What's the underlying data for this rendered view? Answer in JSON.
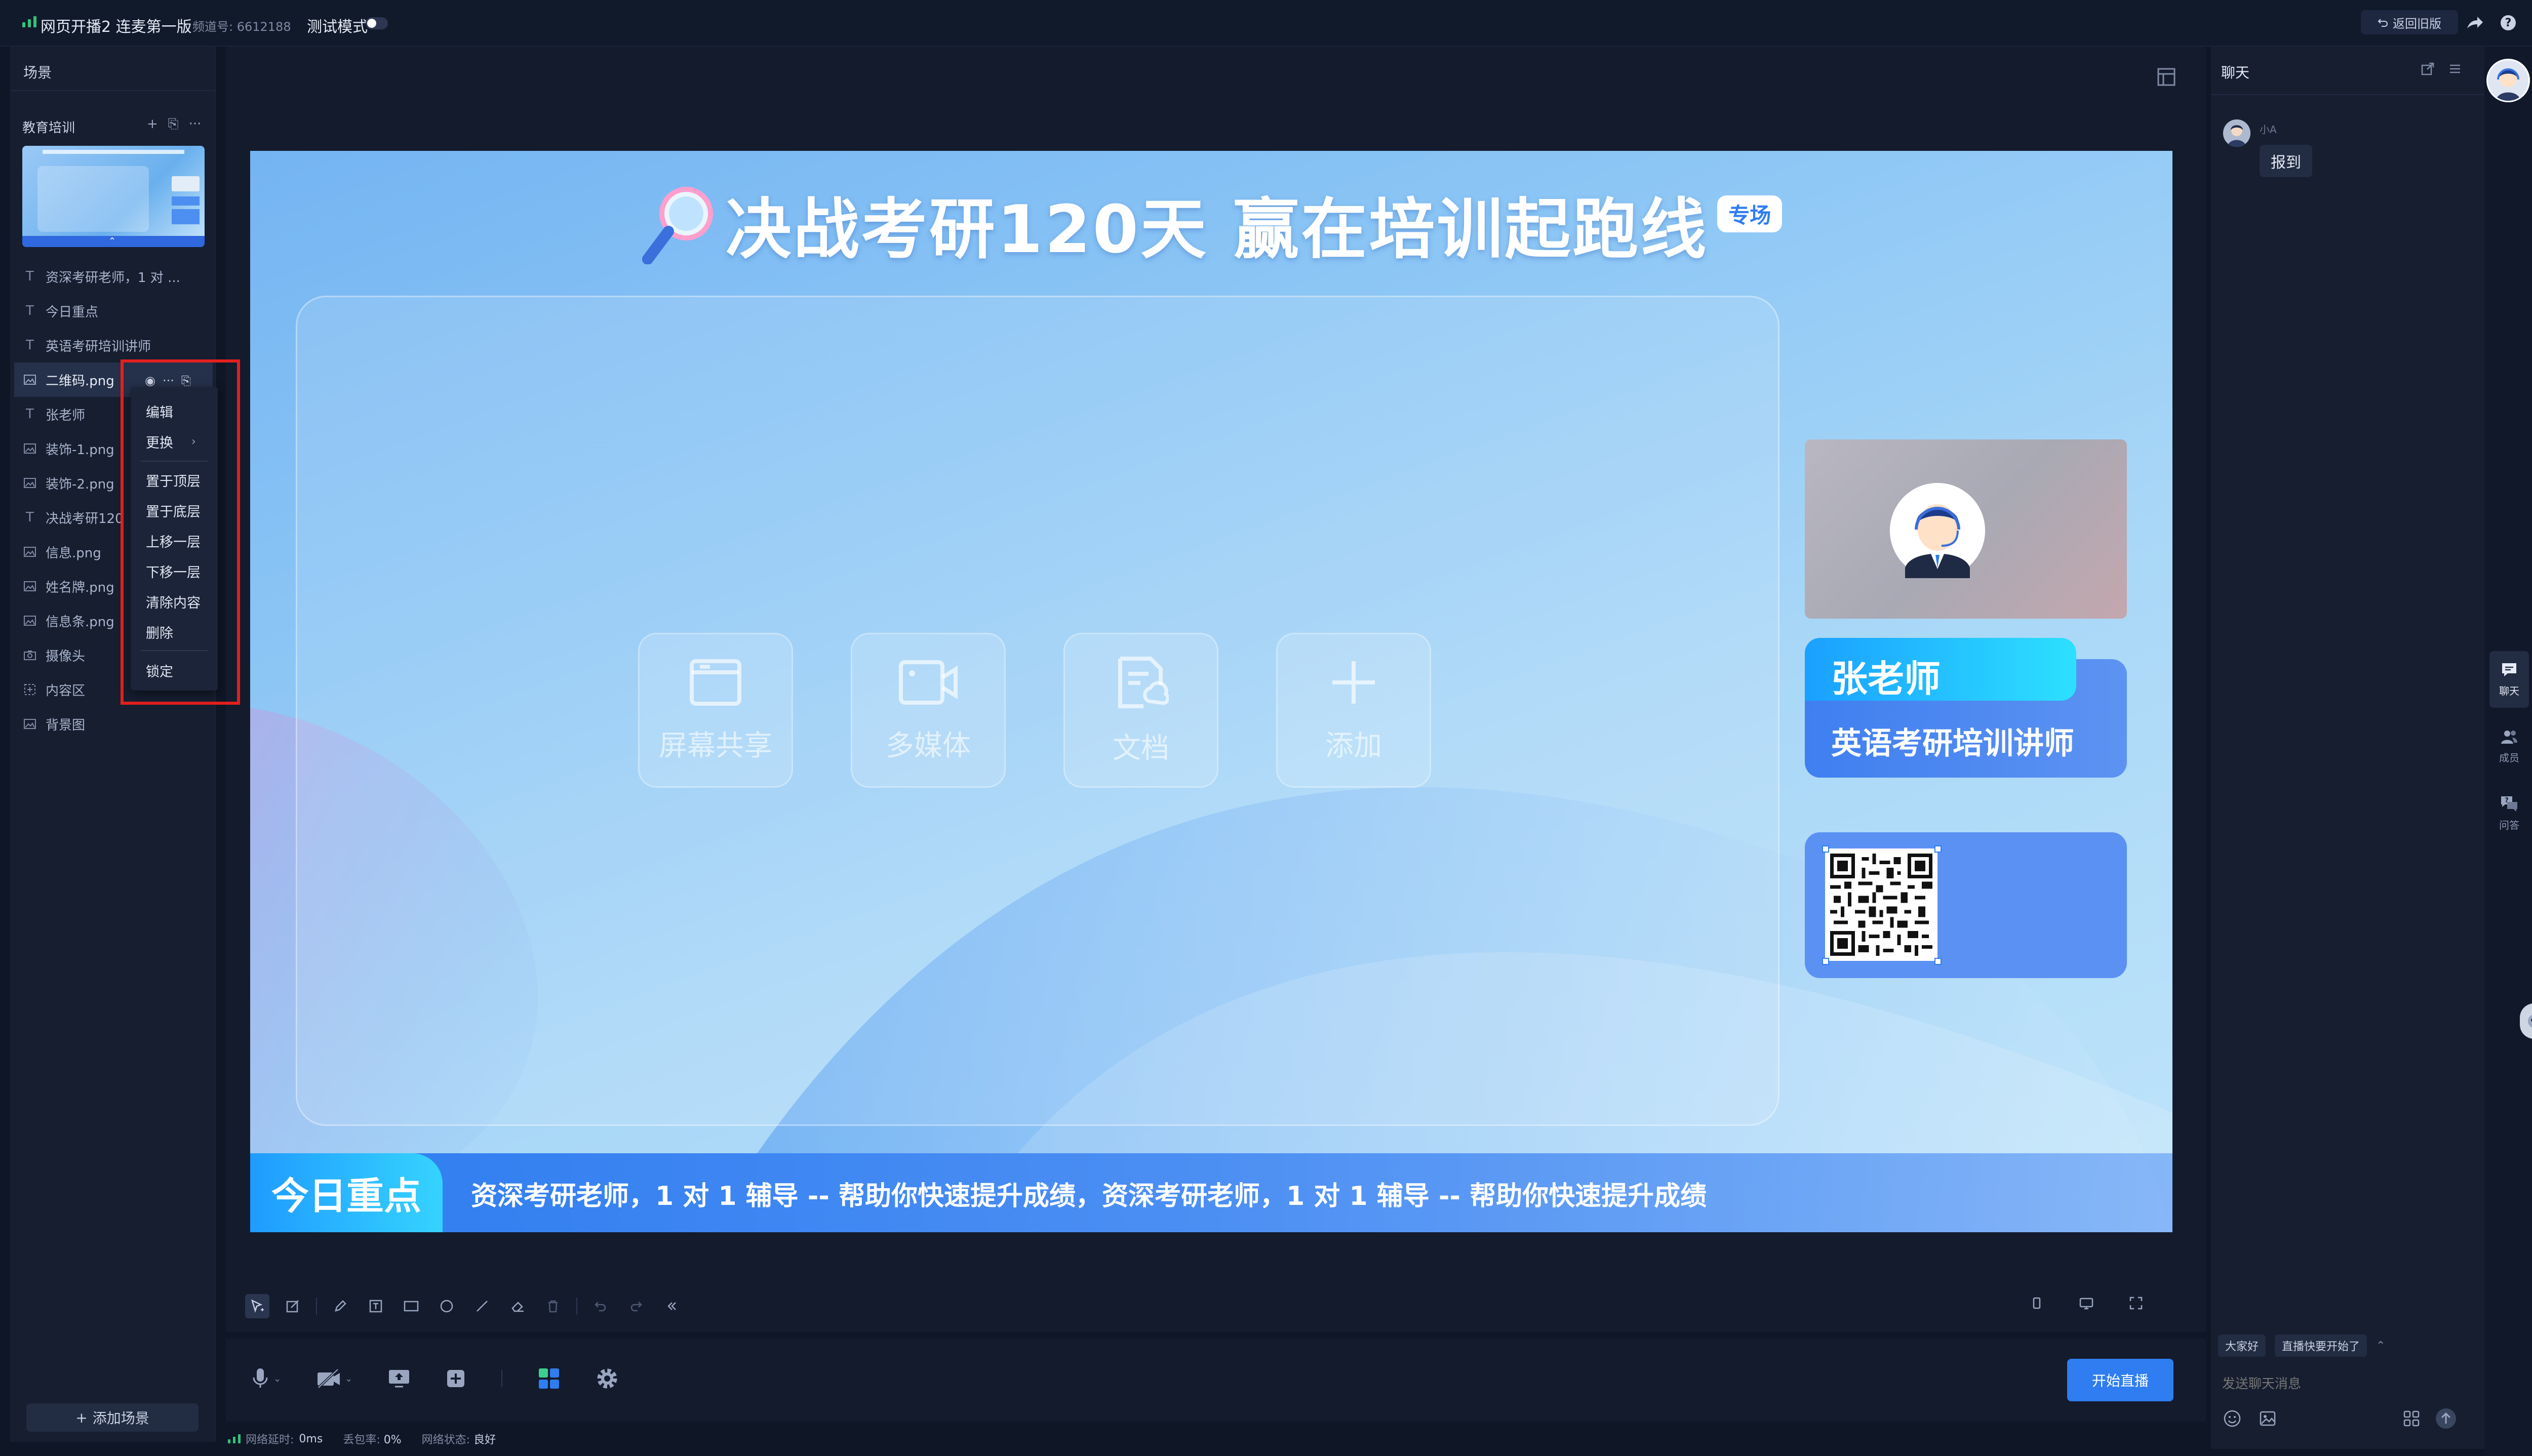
{
  "topbar": {
    "title": "网页开播2 连麦第一版",
    "channel": "频道号: 6612188",
    "test_mode_label": "测试模式",
    "test_mode_on": false,
    "back_old_label": "返回旧版",
    "share_icon": "share-icon",
    "help_icon": "help-icon"
  },
  "scenes": {
    "header": "场景",
    "group_name": "教育培训",
    "add_scene_label": "添加场景",
    "layers": [
      {
        "label": "资深考研老师，1 对 ...",
        "icon": "text-icon"
      },
      {
        "label": "今日重点",
        "icon": "text-icon"
      },
      {
        "label": "英语考研培训讲师",
        "icon": "text-icon"
      },
      {
        "label": "二维码.png",
        "icon": "image-icon",
        "selected": true
      },
      {
        "label": "张老师",
        "icon": "text-icon"
      },
      {
        "label": "装饰-1.png",
        "icon": "image-icon"
      },
      {
        "label": "装饰-2.png",
        "icon": "image-icon"
      },
      {
        "label": "决战考研120",
        "icon": "text-icon"
      },
      {
        "label": "信息.png",
        "icon": "image-icon"
      },
      {
        "label": "姓名牌.png",
        "icon": "image-icon"
      },
      {
        "label": "信息条.png",
        "icon": "image-icon"
      },
      {
        "label": "摄像头",
        "icon": "camera-icon"
      },
      {
        "label": "内容区",
        "icon": "content-icon"
      },
      {
        "label": "背景图",
        "icon": "image-icon"
      }
    ]
  },
  "context_menu": {
    "items": [
      "编辑",
      "更换",
      "置于顶层",
      "置于底层",
      "上移一层",
      "下移一层",
      "清除内容",
      "删除",
      "锁定"
    ]
  },
  "slide": {
    "title": "决战考研120天 赢在培训起跑线",
    "badge": "专场",
    "tiles": [
      "屏幕共享",
      "多媒体",
      "文档",
      "添加"
    ],
    "teacher_name": "张老师",
    "teacher_title": "英语考研培训讲师",
    "ticker_tag": "今日重点",
    "ticker_text": "资深考研老师，1 对 1 辅导 -- 帮助你快速提升成绩，资深考研老师，1 对 1 辅导 -- 帮助你快速提升成绩"
  },
  "controls": {
    "go_live": "开始直播"
  },
  "status": {
    "latency_label": "网络延时:",
    "latency_value": "0ms",
    "loss_label": "丢包率:",
    "loss_value": "0%",
    "state_label": "网络状态:",
    "state_value": "良好"
  },
  "chat": {
    "title": "聊天",
    "messages": [
      {
        "user": "小A",
        "text": "报到"
      }
    ],
    "quick_replies": [
      "大家好",
      "直播快要开始了"
    ],
    "input_placeholder": "发送聊天消息"
  },
  "rail": {
    "items": [
      {
        "label": "聊天",
        "icon": "chat-icon",
        "active": true
      },
      {
        "label": "成员",
        "icon": "members-icon"
      },
      {
        "label": "问答",
        "icon": "qa-icon"
      }
    ]
  },
  "colors": {
    "accent": "#2f7df0",
    "background": "#0f1626",
    "panel": "#161e30",
    "highlight_frame": "#e3201e",
    "signal": "#34c27a"
  }
}
